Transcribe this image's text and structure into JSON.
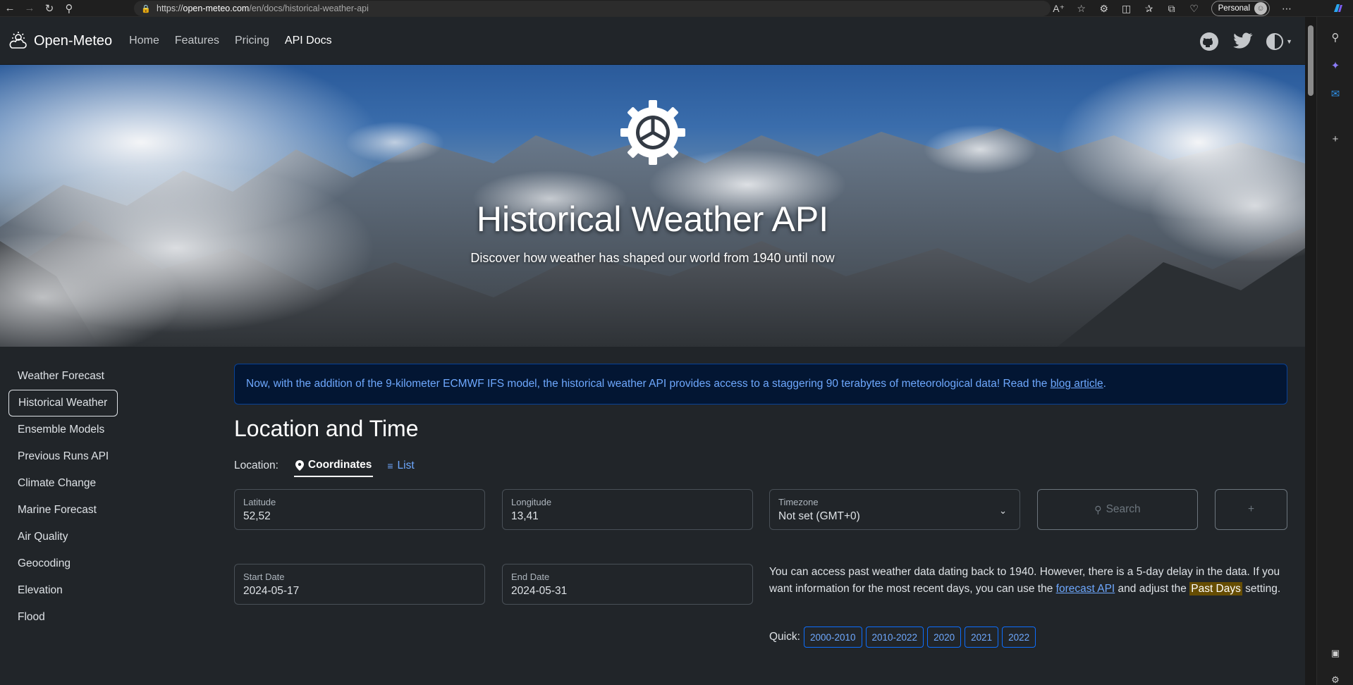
{
  "browser": {
    "url_host": "open-meteo.com",
    "url_prefix": "https://",
    "url_path": "/en/docs/historical-weather-api",
    "profile_label": "Personal"
  },
  "nav": {
    "brand": "Open-Meteo",
    "links": [
      "Home",
      "Features",
      "Pricing",
      "API Docs"
    ]
  },
  "hero": {
    "title": "Historical Weather API",
    "subtitle": "Discover how weather has shaped our world from 1940 until now"
  },
  "sidebar": {
    "items": [
      "Weather Forecast",
      "Historical Weather",
      "Ensemble Models",
      "Previous Runs API",
      "Climate Change",
      "Marine Forecast",
      "Air Quality",
      "Geocoding",
      "Elevation",
      "Flood"
    ],
    "active": "Historical Weather"
  },
  "alert": {
    "text": "Now, with the addition of the 9-kilometer ECMWF IFS model, the historical weather API provides access to a staggering 90 terabytes of meteorological data! Read the ",
    "link": "blog article",
    "end": "."
  },
  "location": {
    "title": "Location and Time",
    "label": "Location:",
    "tab_coordinates": "Coordinates",
    "tab_list": "List",
    "latitude_label": "Latitude",
    "latitude_value": "52,52",
    "longitude_label": "Longitude",
    "longitude_value": "13,41",
    "timezone_label": "Timezone",
    "timezone_value": "Not set (GMT+0)",
    "search_label": "Search",
    "add_label": "+",
    "start_label": "Start Date",
    "start_value": "2024-05-17",
    "end_label": "End Date",
    "end_value": "2024-05-31"
  },
  "info": {
    "text1": "You can access past weather data dating back to 1940. However, there is a 5-day delay in the data. If you want information for the most recent days, you can use the ",
    "link": "forecast API",
    "text2": " and adjust the ",
    "highlight": "Past Days",
    "text3": " setting."
  },
  "quick": {
    "label": "Quick:",
    "ranges": [
      "2000-2010",
      "2010-2022",
      "2020",
      "2021",
      "2022"
    ]
  },
  "colors": {
    "background": "#212529",
    "link": "#6ea8fe",
    "alert_bg": "#031633",
    "highlight": "#664d03"
  }
}
